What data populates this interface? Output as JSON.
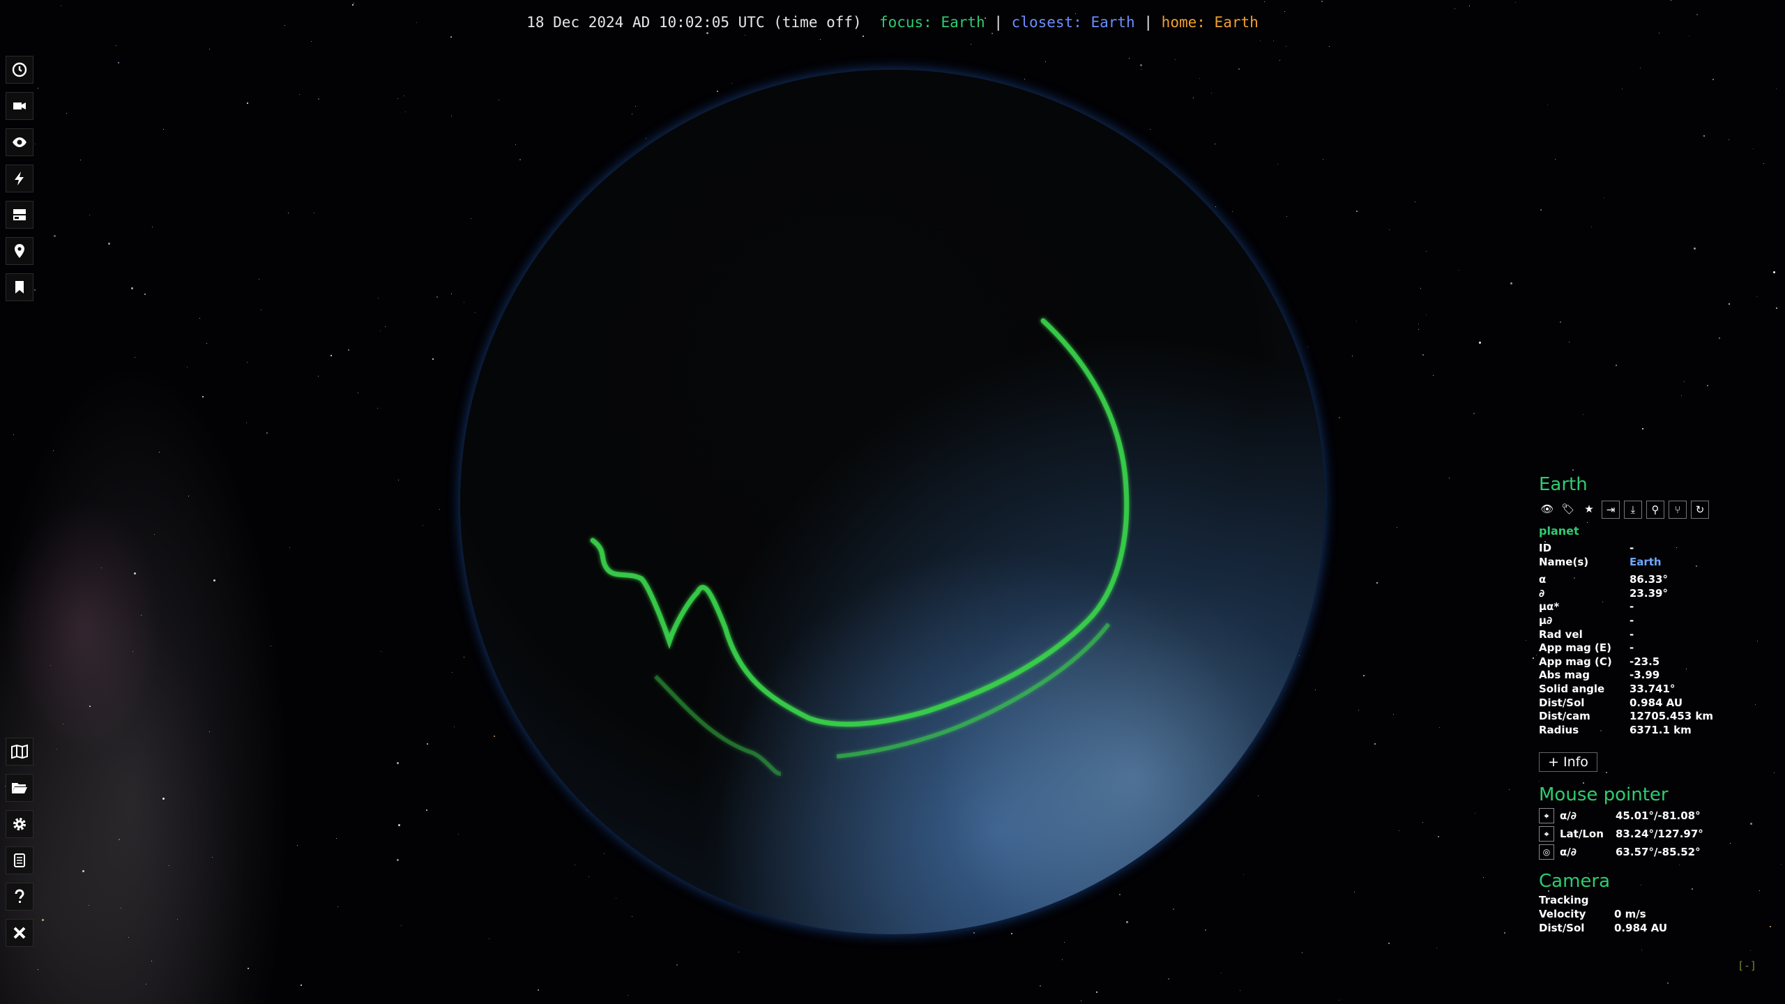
{
  "status_bar": {
    "datetime": "18 Dec 2024 AD 10:02:05 UTC (time off)",
    "focus_label": "focus:",
    "focus_value": "Earth",
    "closest_label": "closest:",
    "closest_value": "Earth",
    "home_label": "home:",
    "home_value": "Earth",
    "separator": "|"
  },
  "colors": {
    "focus": "#2ecc71",
    "closest": "#6d8dff",
    "home": "#f0a030",
    "accent": "#2ecc71",
    "aurora": "#3ad24a"
  },
  "toolbar_top": [
    "clock-icon",
    "camera-icon",
    "eye-icon",
    "bolt-icon",
    "panel-icon",
    "location-pin-icon",
    "bookmark-icon"
  ],
  "toolbar_bottom": [
    "map-icon",
    "folder-icon",
    "gear-icon",
    "log-icon",
    "help-icon",
    "close-icon"
  ],
  "object": {
    "name": "Earth",
    "type": "planet",
    "actions": [
      "eye-icon",
      "tag-icon",
      "star-icon",
      "goto-icon",
      "download-icon",
      "landing-icon",
      "proc-icon",
      "refresh-icon"
    ],
    "rows": [
      {
        "k": "ID",
        "v": "-"
      },
      {
        "k": "Name(s)",
        "v": "Earth",
        "link": true
      },
      {
        "k": "α",
        "v": "86.33°"
      },
      {
        "k": "∂",
        "v": "23.39°"
      },
      {
        "k": "μα*",
        "v": "-"
      },
      {
        "k": "μ∂",
        "v": "-"
      },
      {
        "k": "Rad vel",
        "v": "-"
      },
      {
        "k": "App mag (E)",
        "v": "-"
      },
      {
        "k": "App mag (C)",
        "v": "-23.5"
      },
      {
        "k": "Abs mag",
        "v": "-3.99"
      },
      {
        "k": "Solid angle",
        "v": "33.741°"
      },
      {
        "k": "Dist/Sol",
        "v": "0.984 AU"
      },
      {
        "k": "Dist/cam",
        "v": "12705.453 km"
      },
      {
        "k": "Radius",
        "v": "6371.1 km"
      }
    ],
    "more_button": "+ Info"
  },
  "mouse_pointer": {
    "title": "Mouse pointer",
    "rows": [
      {
        "icon": "pointer-icon",
        "k": "α/∂",
        "v": "45.01°/-81.08°"
      },
      {
        "icon": "pointer-icon",
        "k": "Lat/Lon",
        "v": "83.24°/127.97°"
      },
      {
        "icon": "view-icon",
        "k": "α/∂",
        "v": "63.57°/-85.52°"
      }
    ]
  },
  "camera": {
    "title": "Camera",
    "tracking_label": "Tracking",
    "rows": [
      {
        "k": "Velocity",
        "v": "0 m/s"
      },
      {
        "k": "Dist/Sol",
        "v": "0.984 AU"
      }
    ]
  },
  "collapse_toggle": "[-]"
}
